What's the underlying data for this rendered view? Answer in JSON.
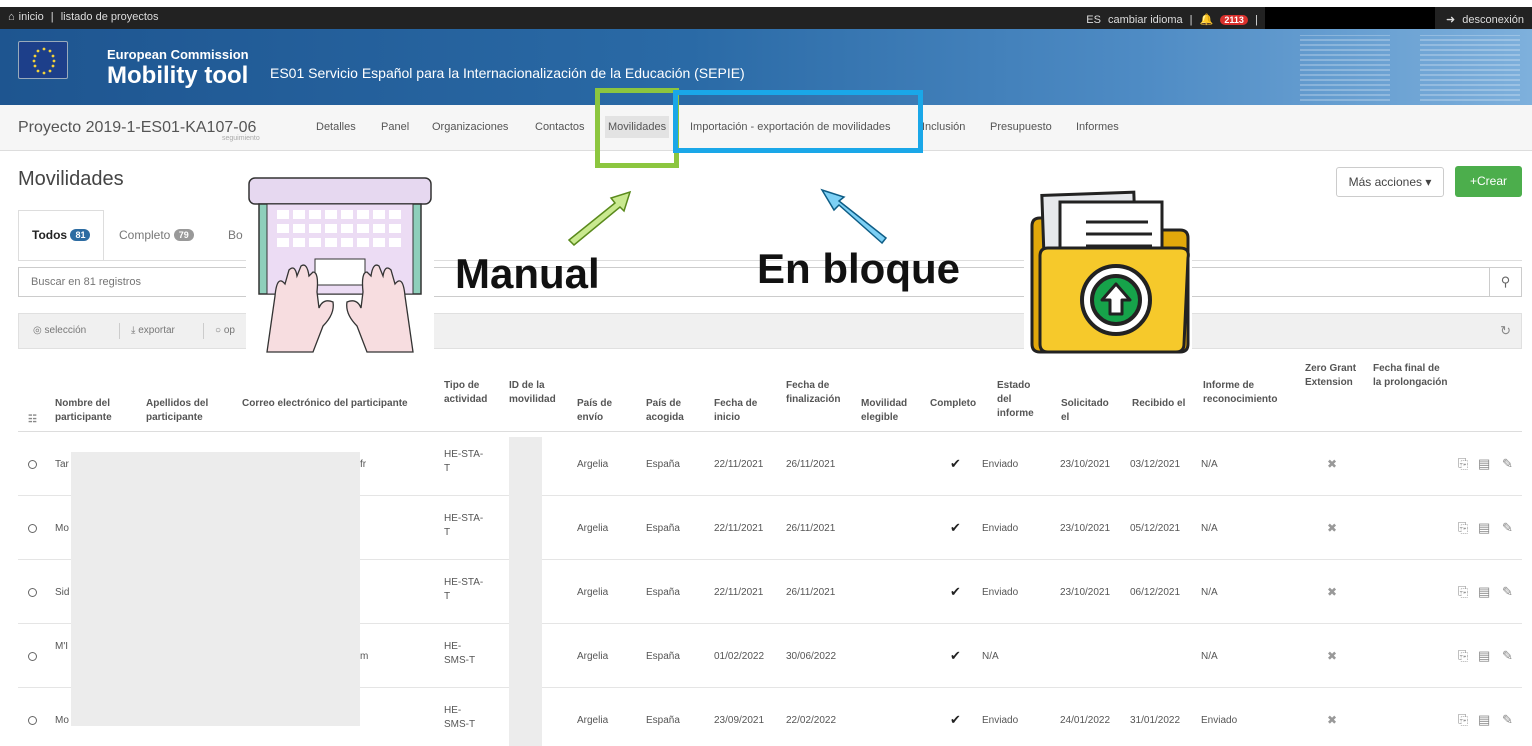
{
  "topbar": {
    "home": "inicio",
    "sep": "|",
    "projects": "listado de proyectos",
    "lang": "ES",
    "change_lang": "cambiar idioma",
    "sep2": "|",
    "notif_count": "2113",
    "sep3": "|",
    "logout": "desconexión"
  },
  "banner": {
    "org": "European Commission",
    "app": "Mobility tool",
    "agency": "ES01 Servicio Español para la Internacionalización de la Educación (SEPIE)"
  },
  "project": {
    "title": "Proyecto 2019-1-ES01-KA107-06",
    "subtitle": "seguimiento"
  },
  "nav": [
    "Detalles",
    "Panel",
    "Organizaciones",
    "Contactos",
    "Movilidades",
    "Importación - exportación de movilidades",
    "Inclusión",
    "Presupuesto",
    "Informes"
  ],
  "page": {
    "title": "Movilidades",
    "more_actions": "Más acciones",
    "create": "Crear"
  },
  "tabs": [
    {
      "label": "Todos",
      "count": "81"
    },
    {
      "label": "Completo",
      "count": "79"
    },
    {
      "label": "Bo"
    }
  ],
  "search": {
    "placeholder": "Buscar en 81 registros"
  },
  "toolbar": {
    "select": "selección",
    "export": "exportar",
    "op": "op"
  },
  "table": {
    "headers": [
      "Nombre del participante",
      "Apellidos del participante",
      "Correo electrónico del participante",
      "Tipo de actividad",
      "ID de la movilidad",
      "País de envío",
      "País de acogida",
      "Fecha de inicio",
      "Fecha de finalización",
      "Movilidad elegible",
      "Completo",
      "Estado del informe",
      "Solicitado el",
      "Recibido el",
      "Informe de reconocimiento",
      "Zero Grant Extension",
      "Fecha final de la prolongación"
    ],
    "rows": [
      {
        "name": "Tar",
        "email": "fr",
        "type": "HE-STA-T",
        "send": "Argelia",
        "host": "España",
        "start": "22/11/2021",
        "end": "26/11/2021",
        "complete": "✔",
        "status": "Enviado",
        "requested": "23/10/2021",
        "received": "03/12/2021",
        "recog": "N/A",
        "zero": "✖"
      },
      {
        "name": "Mo",
        "email": "",
        "type": "HE-STA-T",
        "send": "Argelia",
        "host": "España",
        "start": "22/11/2021",
        "end": "26/11/2021",
        "complete": "✔",
        "status": "Enviado",
        "requested": "23/10/2021",
        "received": "05/12/2021",
        "recog": "N/A",
        "zero": "✖"
      },
      {
        "name": "Sid",
        "email": "",
        "type": "HE-STA-T",
        "send": "Argelia",
        "host": "España",
        "start": "22/11/2021",
        "end": "26/11/2021",
        "complete": "✔",
        "status": "Enviado",
        "requested": "23/10/2021",
        "received": "06/12/2021",
        "recog": "N/A",
        "zero": "✖"
      },
      {
        "name": "M'I Zal",
        "email": "m",
        "type": "HE-SMS-T",
        "send": "Argelia",
        "host": "España",
        "start": "01/02/2022",
        "end": "30/06/2022",
        "complete": "✔",
        "status": "N/A",
        "requested": "",
        "received": "",
        "recog": "N/A",
        "zero": "✖"
      },
      {
        "name": "Mo",
        "email": "",
        "type": "HE-SMS-T",
        "send": "Argelia",
        "host": "España",
        "start": "23/09/2021",
        "end": "22/02/2022",
        "complete": "✔",
        "status": "Enviado",
        "requested": "24/01/2022",
        "received": "31/01/2022",
        "recog": "Enviado",
        "zero": "✖"
      }
    ]
  },
  "annotations": {
    "manual": "Manual",
    "bulk": "En bloque"
  },
  "colors": {
    "green_box": "#8cc63f",
    "blue_box": "#1aa7e8",
    "create_btn": "#4cae4c",
    "badge": "#2d6ca2"
  }
}
